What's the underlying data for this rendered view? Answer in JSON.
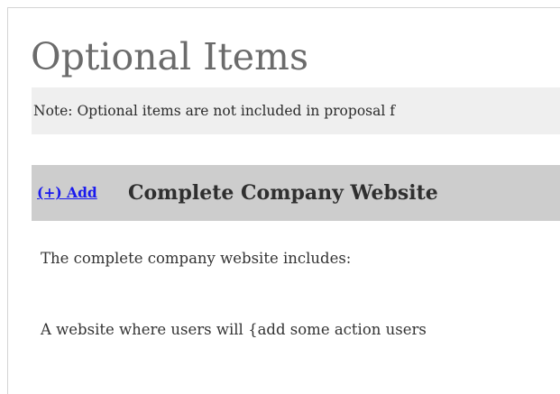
{
  "section": {
    "title": "Optional Items",
    "note": "Note: Optional items are not included in proposal f"
  },
  "optional_item": {
    "add_label": "(+) Add",
    "title": "Complete Company Website",
    "description": [
      "The complete company website includes:",
      "A website where users will {add some action users"
    ]
  },
  "colors": {
    "title_gray": "#6b6b6b",
    "note_bg": "#efefef",
    "header_bg": "#cdcdcd",
    "link_blue": "#1a1aee"
  }
}
